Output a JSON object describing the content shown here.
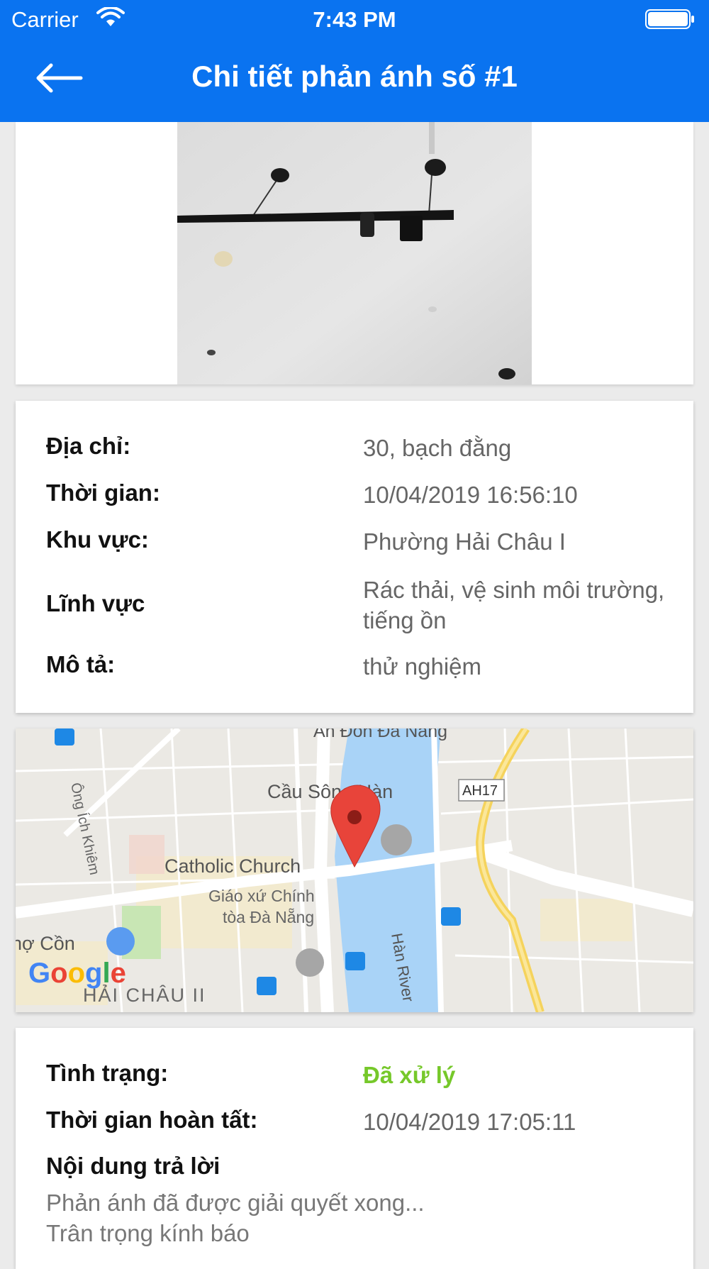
{
  "status_bar": {
    "carrier": "Carrier",
    "time": "7:43 PM"
  },
  "nav": {
    "title": "Chi tiết phản ánh số #1",
    "back_icon": "arrow-left-icon"
  },
  "details": {
    "address_label": "Địa chỉ:",
    "address_value": "30, bạch đằng",
    "time_label": "Thời gian:",
    "time_value": "10/04/2019 16:56:10",
    "area_label": "Khu vực:",
    "area_value": "Phường Hải Châu I",
    "field_label": "Lĩnh vực",
    "field_value": "Rác thải, vệ sinh môi trường, tiếng ồn",
    "desc_label": "Mô tả:",
    "desc_value": "thử nghiệm"
  },
  "map": {
    "labels": {
      "an_don": "An Đồn Đà Nẵng",
      "bridge": "Cầu Sông Hàn",
      "route": "AH17",
      "street": "Ông Ích Khiêm",
      "church": "Catholic Church",
      "parish": "Giáo xứ Chính\ntòa Đà Nẵng",
      "market": "hợ Cồn",
      "district": "HẢI CHÂU II",
      "river": "Hàn River",
      "google": "Google"
    },
    "colors": {
      "water": "#a9d3f7",
      "road": "#ffffff",
      "highway": "#f5d35c",
      "pin": "#e8443a"
    }
  },
  "result": {
    "status_label": "Tình trạng:",
    "status_value": "Đã xử lý",
    "status_color": "#76c82a",
    "done_label": "Thời gian hoàn tất:",
    "done_value": "10/04/2019 17:05:11",
    "reply_title": "Nội dung trả lời",
    "reply_text": "Phản ánh đã được giải quyết xong...\nTrân trọng kính báo"
  }
}
